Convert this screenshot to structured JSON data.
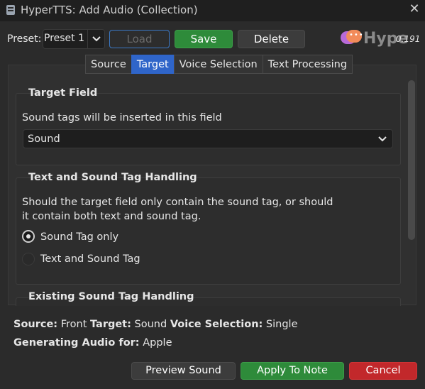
{
  "window": {
    "title": "HyperTTS: Add Audio (Collection)"
  },
  "preset": {
    "label": "Preset:",
    "value": "Preset 1",
    "load": "Load",
    "save": "Save",
    "delete": "Delete"
  },
  "logo": {
    "text": "Hype",
    "version": "0.191"
  },
  "tabs": [
    "Source",
    "Target",
    "Voice Selection",
    "Text Processing"
  ],
  "active_tab": "Target",
  "target_field": {
    "title": "Target Field",
    "description": "Sound tags will be inserted in this field",
    "value": "Sound"
  },
  "tag_handling": {
    "title": "Text and Sound Tag Handling",
    "description_line1": "Should the target field only contain the sound tag, or should",
    "description_line2": "it contain both text and sound tag.",
    "options": [
      "Sound Tag only",
      "Text and Sound Tag"
    ],
    "selected": "Sound Tag only"
  },
  "existing_tag": {
    "title": "Existing Sound Tag Handling"
  },
  "status": {
    "source_label": "Source:",
    "source_value": "Front",
    "target_label": "Target:",
    "target_value": "Sound",
    "voice_label": "Voice Selection:",
    "voice_value": "Single",
    "generating_label": "Generating Audio for:",
    "generating_value": "Apple"
  },
  "buttons": {
    "preview": "Preview Sound",
    "apply": "Apply To Note",
    "cancel": "Cancel"
  },
  "colors": {
    "accent_blue": "#2f65c9",
    "green": "#2e8b3a",
    "red": "#c2282b",
    "background": "#2b2b2b"
  }
}
